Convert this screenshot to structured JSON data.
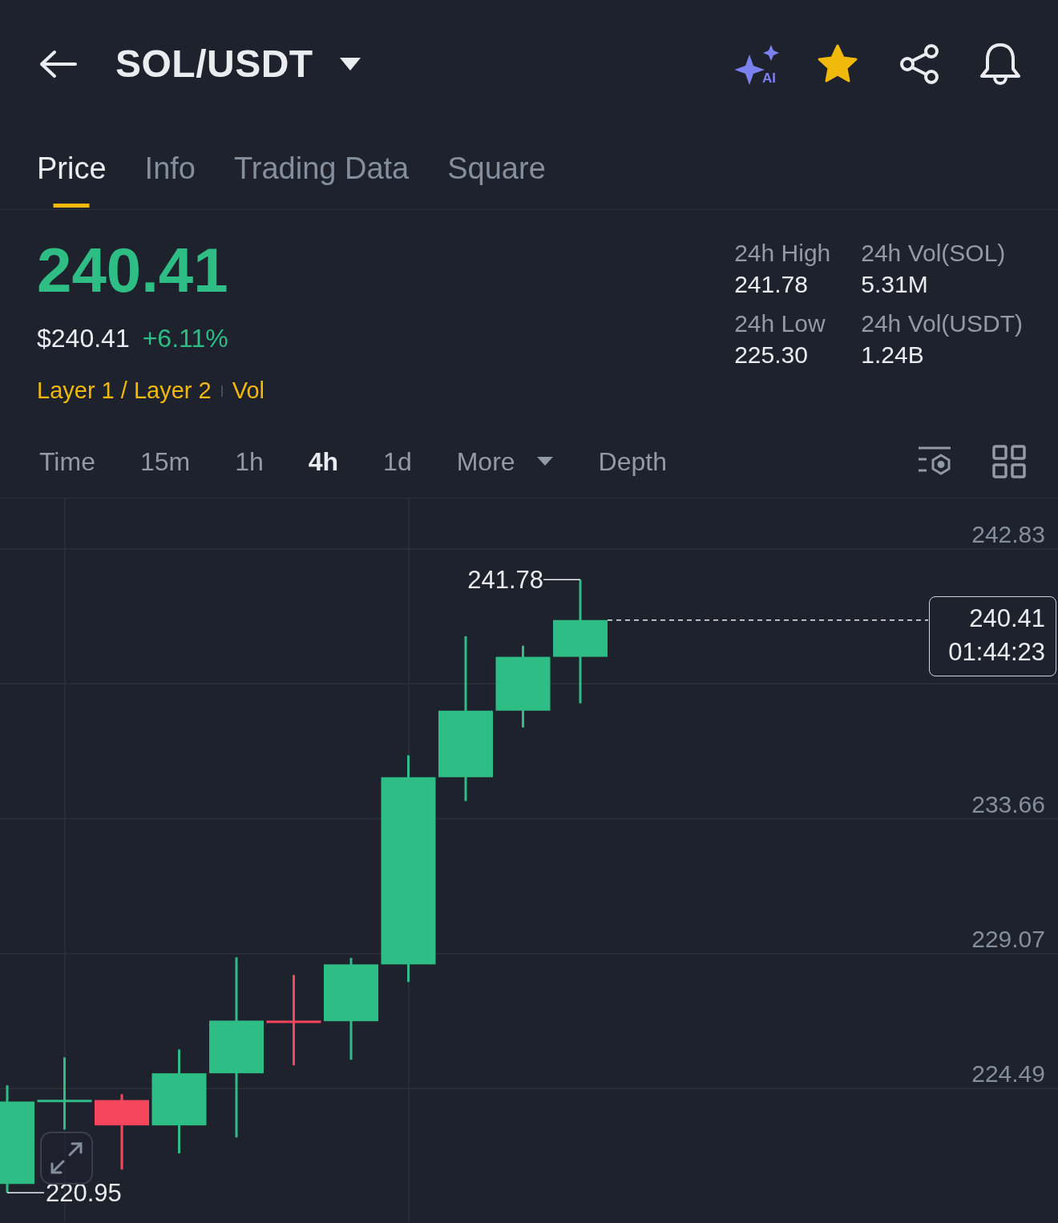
{
  "header": {
    "title": "SOL/USDT",
    "ai_label": "AI",
    "favorite": true
  },
  "tabs": [
    {
      "label": "Price",
      "selected": true
    },
    {
      "label": "Info",
      "selected": false
    },
    {
      "label": "Trading Data",
      "selected": false
    },
    {
      "label": "Square",
      "selected": false
    }
  ],
  "ticker": {
    "price": "240.41",
    "price_usd": "$240.41",
    "change": "+6.11%",
    "tags": [
      "Layer 1 / Layer 2",
      "Vol"
    ]
  },
  "stats": [
    {
      "label": "24h High",
      "value": "241.78"
    },
    {
      "label": "24h Vol(SOL)",
      "value": "5.31M"
    },
    {
      "label": "24h Low",
      "value": "225.30"
    },
    {
      "label": "24h Vol(USDT)",
      "value": "1.24B"
    }
  ],
  "intervals": [
    {
      "label": "Time",
      "kind": "option",
      "selected": false
    },
    {
      "label": "15m",
      "kind": "option",
      "selected": false
    },
    {
      "label": "1h",
      "kind": "option",
      "selected": false
    },
    {
      "label": "4h",
      "kind": "option",
      "selected": true
    },
    {
      "label": "1d",
      "kind": "option",
      "selected": false
    },
    {
      "label": "More",
      "kind": "dropdown",
      "selected": false
    },
    {
      "label": "Depth",
      "kind": "option",
      "selected": false
    }
  ],
  "chart": {
    "price_axis": [
      "242.83",
      "233.66",
      "229.07",
      "224.49"
    ],
    "high_label": "241.78",
    "low_label": "220.95",
    "price_tag": {
      "price": "240.41",
      "countdown": "01:44:23"
    }
  }
}
